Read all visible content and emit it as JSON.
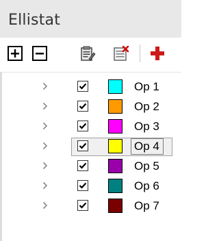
{
  "panel": {
    "title": "Ellistat"
  },
  "toolbar": {
    "buttons": [
      {
        "icon": "plus-box-icon"
      },
      {
        "icon": "minus-box-icon"
      },
      {
        "icon": "clipboard-edit-icon"
      },
      {
        "icon": "list-delete-icon"
      },
      {
        "icon": "red-plus-icon"
      }
    ]
  },
  "tree": {
    "items": [
      {
        "label": "Op 1",
        "checked": true,
        "color": "#00ffff",
        "selected": false
      },
      {
        "label": "Op 2",
        "checked": true,
        "color": "#ff9900",
        "selected": false
      },
      {
        "label": "Op 3",
        "checked": true,
        "color": "#ff00ff",
        "selected": false
      },
      {
        "label": "Op 4",
        "checked": true,
        "color": "#ffff00",
        "selected": true
      },
      {
        "label": "Op 5",
        "checked": true,
        "color": "#9900aa",
        "selected": false
      },
      {
        "label": "Op 6",
        "checked": true,
        "color": "#008080",
        "selected": false
      },
      {
        "label": "Op 7",
        "checked": true,
        "color": "#7a0000",
        "selected": false
      }
    ]
  }
}
